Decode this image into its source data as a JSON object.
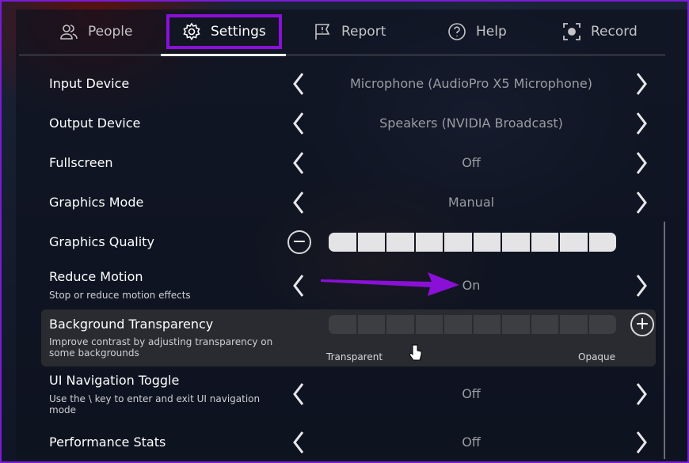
{
  "tabs": [
    {
      "label": "People",
      "icon": "people-icon"
    },
    {
      "label": "Settings",
      "icon": "gear-icon",
      "selected": true
    },
    {
      "label": "Report",
      "icon": "flag-icon"
    },
    {
      "label": "Help",
      "icon": "help-icon"
    },
    {
      "label": "Record",
      "icon": "record-icon"
    }
  ],
  "settings": [
    {
      "label": "Input Device",
      "value": "Microphone (AudioPro X5 Microphone)"
    },
    {
      "label": "Output Device",
      "value": "Speakers (NVIDIA Broadcast)"
    },
    {
      "label": "Fullscreen",
      "value": "Off"
    },
    {
      "label": "Graphics Mode",
      "value": "Manual"
    },
    {
      "label": "Graphics Quality",
      "level": 10,
      "max": 10
    },
    {
      "label": "Reduce Motion",
      "description": "Stop or reduce motion effects",
      "value": "On"
    },
    {
      "label": "Background Transparency",
      "description": "Improve contrast by adjusting transparency on some backgrounds",
      "level": 0,
      "max": 10,
      "min_label": "Transparent",
      "max_label": "Opaque"
    },
    {
      "label": "UI Navigation Toggle",
      "description": "Use the \\ key to enter and exit UI navigation mode",
      "value": "Off"
    },
    {
      "label": "Performance Stats",
      "value": "Off"
    }
  ],
  "colors": {
    "highlight": "#8a10d8",
    "arrow": "#8a10d8"
  }
}
